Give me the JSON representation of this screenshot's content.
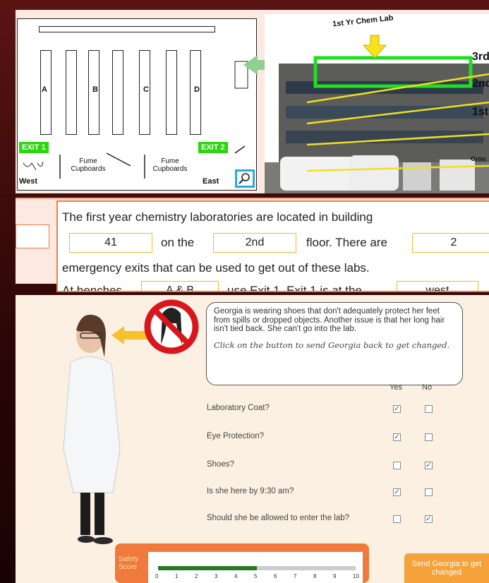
{
  "floorplan": {
    "benches": [
      "A",
      "B",
      "C",
      "D"
    ],
    "exit1": "EXIT 1",
    "exit2": "EXIT 2",
    "fume1": [
      "Fume",
      "Cupboards"
    ],
    "fume2": [
      "Fume",
      "Cupboards"
    ],
    "west": "West",
    "east": "East"
  },
  "photo": {
    "lab_label": "1st Yr Chem Lab",
    "floors": [
      "3rd",
      "2nd",
      "1st",
      "Grou"
    ]
  },
  "question": {
    "line1": "The first year chemistry laboratories are located in building",
    "answer_building": "41",
    "on_the": "on the",
    "answer_floor": "2nd",
    "floor_there_are": "floor. There are",
    "answer_exits": "2",
    "line3": "emergency exits that can be used to get out of these labs.",
    "at_benches": "At benches",
    "answer_benches": "A & B",
    "use_exit": "use Exit 1. Exit 1 is at the",
    "answer_side": "west"
  },
  "scenario": {
    "speech": "Georgia is wearing shoes that don't adequately protect her feet from spills or dropped objects. Another issue is that her long hair isn't tied back. She can't go into the lab.",
    "instruction": "Click on the button to send Georgia back to get changed.",
    "col_yes": "Yes",
    "col_no": "No",
    "questions": [
      {
        "label": "Laboratory Coat?",
        "yes": true,
        "no": false
      },
      {
        "label": "Eye Protection?",
        "yes": true,
        "no": false
      },
      {
        "label": "Shoes?",
        "yes": false,
        "no": true
      },
      {
        "label": "Is she here by 9:30 am?",
        "yes": true,
        "no": false
      },
      {
        "label": "Should she be allowed to enter the lab?",
        "yes": false,
        "no": true
      }
    ],
    "score_label": [
      "Safety",
      "Score"
    ],
    "score_ticks": [
      "0",
      "1",
      "2",
      "3",
      "4",
      "5",
      "6",
      "7",
      "8",
      "9",
      "10"
    ],
    "score_value": 5,
    "send_button": "Send Georgia to get changed"
  },
  "colors": {
    "exit_green": "#2bd60f",
    "accent_orange": "#f07f3c",
    "highlight_yellow": "#f7b92b",
    "arrow_green": "#8fcf8f"
  }
}
